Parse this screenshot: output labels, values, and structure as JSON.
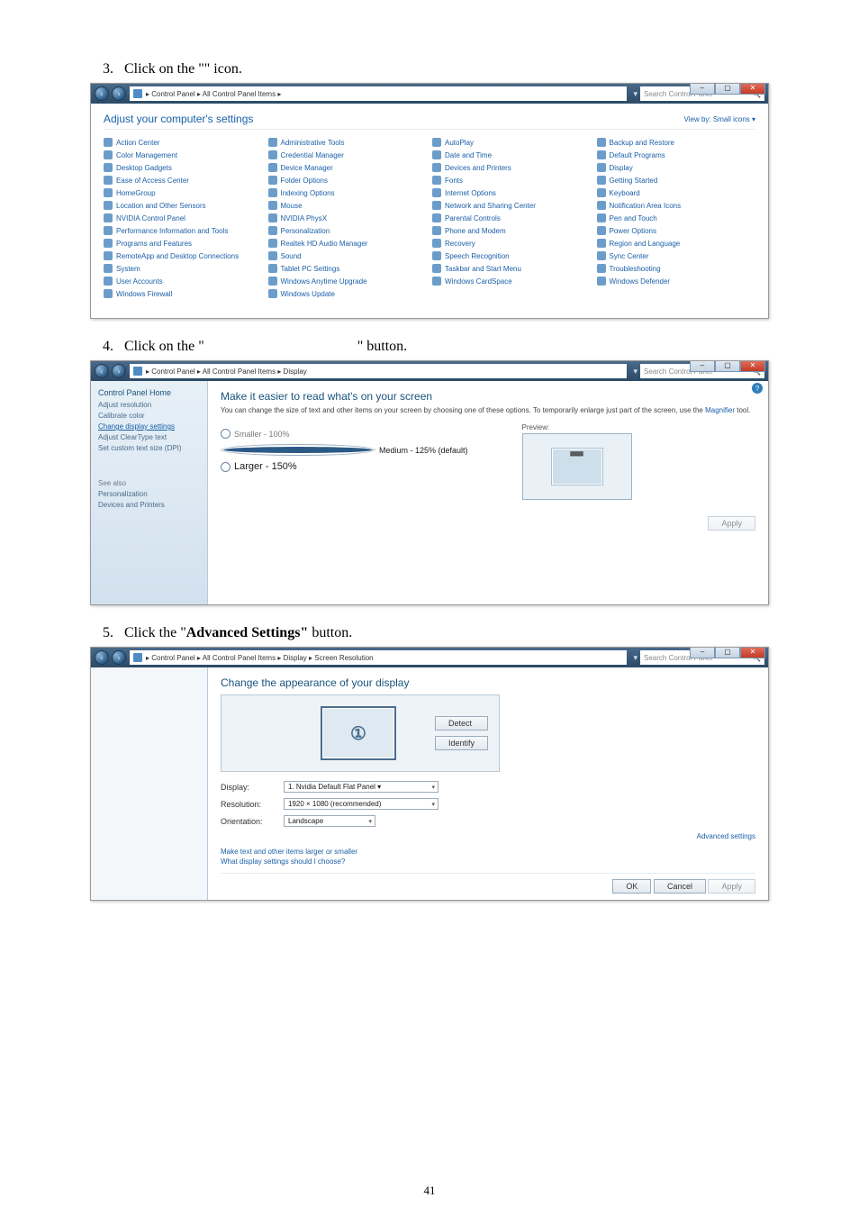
{
  "step3": {
    "num": "3.",
    "text_pre": "Click on the \"",
    "text_mid": "",
    "text_post": "\" icon."
  },
  "step4": {
    "num": "4.",
    "text_pre": "Click on the \"",
    "text_mid": "",
    "text_post": "\" button."
  },
  "step5": {
    "num": "5.",
    "text_pre": "Click the \"",
    "bold": "Advanced Settings\"",
    "text_post": " button."
  },
  "win1": {
    "breadcrumb": "▸ Control Panel ▸ All Control Panel Items ▸",
    "search_placeholder": "Search Control Panel",
    "panel_title": "Adjust your computer's settings",
    "viewby": "View by:  Small icons ▾",
    "items": [
      "Action Center",
      "Administrative Tools",
      "AutoPlay",
      "Backup and Restore",
      "Color Management",
      "Credential Manager",
      "Date and Time",
      "Default Programs",
      "Desktop Gadgets",
      "Device Manager",
      "Devices and Printers",
      "Display",
      "Ease of Access Center",
      "Folder Options",
      "Fonts",
      "Getting Started",
      "HomeGroup",
      "Indexing Options",
      "Internet Options",
      "Keyboard",
      "Location and Other Sensors",
      "Mouse",
      "Network and Sharing Center",
      "Notification Area Icons",
      "NVIDIA Control Panel",
      "NVIDIA PhysX",
      "Parental Controls",
      "Pen and Touch",
      "Performance Information and Tools",
      "Personalization",
      "Phone and Modem",
      "Power Options",
      "Programs and Features",
      "Realtek HD Audio Manager",
      "Recovery",
      "Region and Language",
      "RemoteApp and Desktop Connections",
      "Sound",
      "Speech Recognition",
      "Sync Center",
      "System",
      "Tablet PC Settings",
      "Taskbar and Start Menu",
      "Troubleshooting",
      "User Accounts",
      "Windows Anytime Upgrade",
      "Windows CardSpace",
      "Windows Defender",
      "Windows Firewall",
      "Windows Update"
    ]
  },
  "win2": {
    "breadcrumb": "▸ Control Panel ▸ All Control Panel Items ▸ Display",
    "search_placeholder": "Search Control Panel",
    "sidebar": {
      "home": "Control Panel Home",
      "items": [
        "Adjust resolution",
        "Calibrate color",
        "Change display settings",
        "Adjust ClearType text",
        "Set custom text size (DPI)"
      ],
      "seealso": "See also",
      "footer": [
        "Personalization",
        "Devices and Printers"
      ]
    },
    "title": "Make it easier to read what's on your screen",
    "desc_a": "You can change the size of text and other items on your screen by choosing one of these options. To temporarily enlarge just part of the screen, use the ",
    "desc_link": "Magnifier",
    "desc_b": " tool.",
    "radios": {
      "small": "Smaller - 100%",
      "medium": "Medium - 125% (default)",
      "large": "Larger - 150%"
    },
    "preview_label": "Preview:",
    "apply": "Apply"
  },
  "win3": {
    "breadcrumb": "▸ Control Panel ▸ All Control Panel Items ▸ Display ▸ Screen Resolution",
    "search_placeholder": "Search Control Panel",
    "title": "Change the appearance of your display",
    "monitor_num": "1",
    "btn_detect": "Detect",
    "btn_identify": "Identify",
    "field_display": {
      "k": "Display:",
      "v": "1. Nvidia Default Flat Panel ▾"
    },
    "field_res": {
      "k": "Resolution:",
      "v": "1920 × 1080 (recommended)"
    },
    "field_orient": {
      "k": "Orientation:",
      "v": "Landscape"
    },
    "advanced_link": "Advanced settings",
    "link_larger": "Make text and other items larger or smaller",
    "link_what": "What display settings should I choose?",
    "btn_ok": "OK",
    "btn_cancel": "Cancel",
    "btn_apply": "Apply"
  },
  "page_number": "41"
}
